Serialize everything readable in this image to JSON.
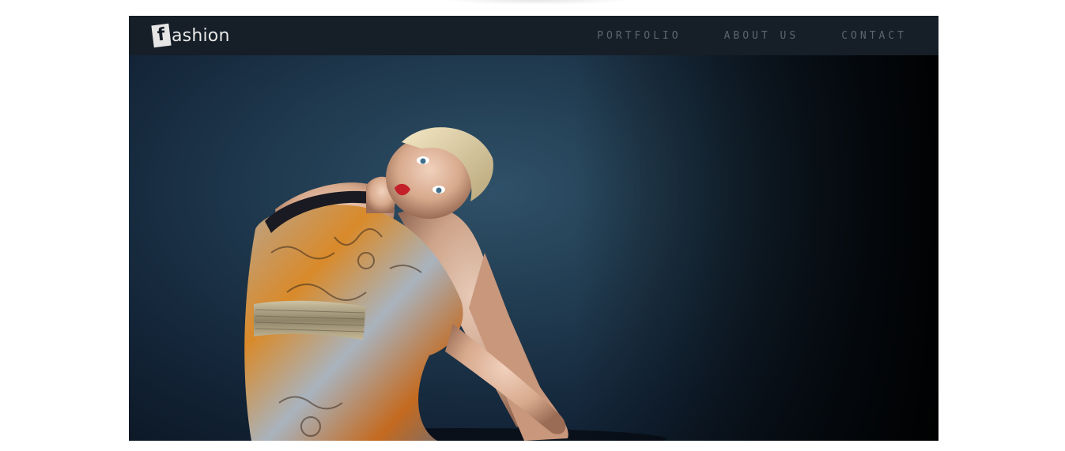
{
  "header": {
    "logo": {
      "box_letter": "f",
      "text": "ashion"
    },
    "nav": [
      {
        "label": "PORTFOLIO"
      },
      {
        "label": "ABOUT US"
      },
      {
        "label": "CONTACT"
      }
    ]
  },
  "hero": {
    "image": "fashion-model-photo"
  },
  "colors": {
    "navbar": "#161e27",
    "nav_text": "#5a6672",
    "logo_text": "#e8e8e8",
    "hero_bg": "#203a4f"
  }
}
